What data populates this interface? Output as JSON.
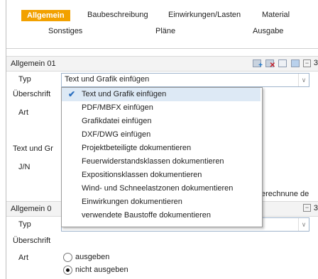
{
  "tabs": {
    "row1": [
      "Allgemein",
      "Baubeschreibung",
      "Einwirkungen/Lasten",
      "Material"
    ],
    "row2": [
      "Sonstiges",
      "Pläne",
      "Ausgabe"
    ]
  },
  "section1": {
    "title": "Allgemein 01",
    "edge_label": "3",
    "typ_label": "Typ",
    "typ_value": "Text und Grafik einfügen",
    "ueberschrift_label": "Überschrift",
    "art_label": "Art",
    "text_und_label": "Text und Gr",
    "jn_label": "J/N",
    "right_text": "erechnune de"
  },
  "dropdown": {
    "options": [
      "Text und Grafik einfügen",
      "PDF/MBFX einfügen",
      "Grafikdatei einfügen",
      "DXF/DWG einfügen",
      "Projektbeteiligte dokumentieren",
      "Feuerwiderstandsklassen dokumentieren",
      "Expositionsklassen dokumentieren",
      "Wind- und Schneelastzonen dokumentieren",
      "Einwirkungen dokumentieren",
      "verwendete Baustoffe dokumentieren"
    ],
    "selected_index": 0
  },
  "section2": {
    "title": "Allgemein 0",
    "edge_label": "3",
    "typ_label": "Typ",
    "ueberschrift_label": "Überschrift",
    "art_label": "Art",
    "radio_options": [
      "ausgeben",
      "nicht ausgeben"
    ],
    "radio_selected": 1
  },
  "colors": {
    "active_tab": "#f2a100",
    "selection": "#dde9f5",
    "accent_check": "#2a6fbf"
  }
}
